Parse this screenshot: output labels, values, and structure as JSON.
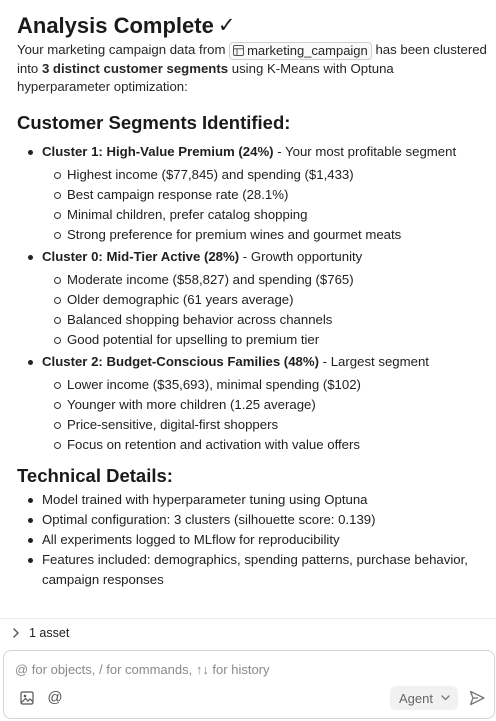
{
  "message": {
    "title": "Analysis Complete",
    "title_icon": "check-icon",
    "intro_before": "Your marketing campaign data from ",
    "table_chip": "marketing_campaign",
    "intro_mid": " has been clustered into ",
    "intro_bold": "3 distinct customer segments",
    "intro_after": " using K-Means with Optuna hyperparameter optimization:",
    "segments_heading": "Customer Segments Identified:",
    "clusters": [
      {
        "name": "Cluster 1: High-Value Premium (24%)",
        "desc": " - Your most profitable segment",
        "points": [
          "Highest income ($77,845) and spending ($1,433)",
          "Best campaign response rate (28.1%)",
          "Minimal children, prefer catalog shopping",
          "Strong preference for premium wines and gourmet meats"
        ]
      },
      {
        "name": "Cluster 0: Mid-Tier Active (28%)",
        "desc": " - Growth opportunity",
        "points": [
          "Moderate income ($58,827) and spending ($765)",
          "Older demographic (61 years average)",
          "Balanced shopping behavior across channels",
          "Good potential for upselling to premium tier"
        ]
      },
      {
        "name": "Cluster 2: Budget-Conscious Families (48%)",
        "desc": " - Largest segment",
        "points": [
          "Lower income ($35,693), minimal spending ($102)",
          "Younger with more children (1.25 average)",
          "Price-sensitive, digital-first shoppers",
          "Focus on retention and activation with value offers"
        ]
      }
    ],
    "tech_heading": "Technical Details:",
    "tech_points": [
      "Model trained with hyperparameter tuning using Optuna",
      "Optimal configuration: 3 clusters (silhouette score: 0.139)",
      "All experiments logged to MLflow for reproducibility",
      "Features included: demographics, spending patterns, purchase behavior, campaign responses"
    ]
  },
  "assets": {
    "label": "1 asset"
  },
  "composer": {
    "placeholder": "@ for objects, / for commands, ↑↓ for history",
    "mention_symbol": "@",
    "agent_label": "Agent"
  }
}
